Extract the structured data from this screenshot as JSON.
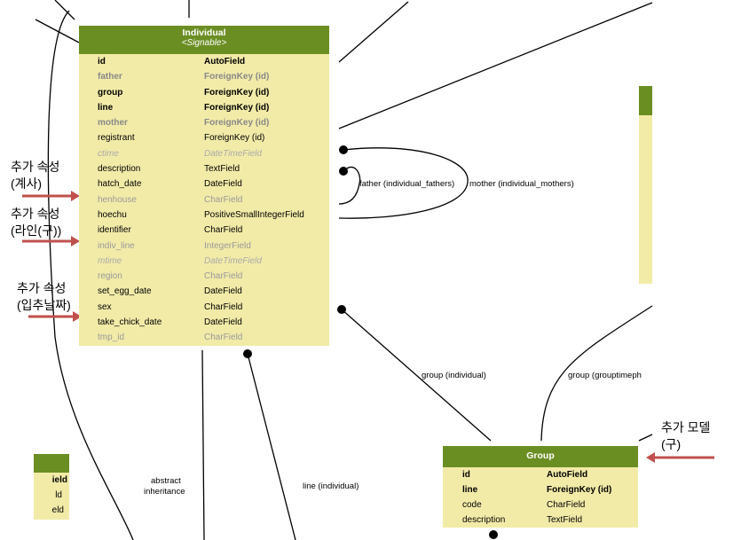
{
  "individual": {
    "title": "Individual",
    "stereotype": "<Signable>",
    "fields": [
      {
        "name": "id",
        "type": "AutoField",
        "style": "b"
      },
      {
        "name": "father",
        "type": "ForeignKey (id)",
        "style": "gb"
      },
      {
        "name": "group",
        "type": "ForeignKey (id)",
        "style": "b"
      },
      {
        "name": "line",
        "type": "ForeignKey (id)",
        "style": "b"
      },
      {
        "name": "mother",
        "type": "ForeignKey (id)",
        "style": "gb"
      },
      {
        "name": "registrant",
        "type": "ForeignKey (id)",
        "style": "n"
      },
      {
        "name": "ctime",
        "type": "DateTimeField",
        "style": "gi"
      },
      {
        "name": "description",
        "type": "TextField",
        "style": "n"
      },
      {
        "name": "hatch_date",
        "type": "DateField",
        "style": "n"
      },
      {
        "name": "henhouse",
        "type": "CharField",
        "style": "g"
      },
      {
        "name": "hoechu",
        "type": "PositiveSmallIntegerField",
        "style": "n"
      },
      {
        "name": "identifier",
        "type": "CharField",
        "style": "n"
      },
      {
        "name": "indiv_line",
        "type": "IntegerField",
        "style": "g"
      },
      {
        "name": "mtime",
        "type": "DateTimeField",
        "style": "gi"
      },
      {
        "name": "region",
        "type": "CharField",
        "style": "g"
      },
      {
        "name": "set_egg_date",
        "type": "DateField",
        "style": "n"
      },
      {
        "name": "sex",
        "type": "CharField",
        "style": "n"
      },
      {
        "name": "take_chick_date",
        "type": "DateField",
        "style": "n"
      },
      {
        "name": "tmp_id",
        "type": "CharField",
        "style": "g"
      }
    ]
  },
  "group": {
    "title": "Group",
    "fields": [
      {
        "name": "id",
        "type": "AutoField",
        "style": "b"
      },
      {
        "name": "line",
        "type": "ForeignKey (id)",
        "style": "b"
      },
      {
        "name": "code",
        "type": "CharField",
        "style": "n"
      },
      {
        "name": "description",
        "type": "TextField",
        "style": "n"
      }
    ]
  },
  "left_partial": {
    "fields": [
      "ield",
      "ld",
      "eld"
    ]
  },
  "relations": {
    "father": "father (individual_fathers)",
    "mother": "mother (individual_mothers)",
    "group": "group (individual)",
    "grouptime": "group (grouptimeph",
    "line": "line (individual)",
    "abstract1": "abstract",
    "abstract2": "inheritance"
  },
  "notes": [
    {
      "line1": "추가 속성",
      "line2": "(계사)"
    },
    {
      "line1": "추가 속성",
      "line2": "(라인(구))"
    },
    {
      "line1": "추가 속성",
      "line2": "(입추날짜)"
    },
    {
      "line1": "추가 모델",
      "line2": "(구)"
    }
  ],
  "colors": {
    "header": "#6b8e23",
    "body": "#f2eba8",
    "arrow": "#c0504d"
  }
}
